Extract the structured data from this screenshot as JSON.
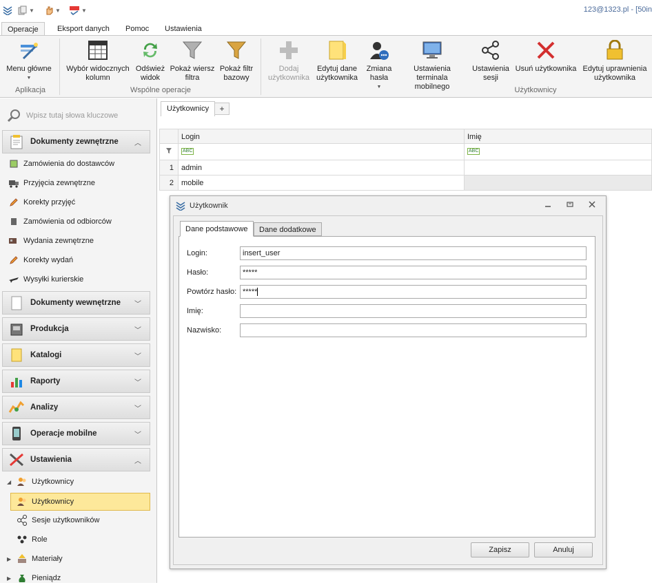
{
  "account": {
    "text": "123@1323.pl - [50in"
  },
  "ribbon_tabs": [
    "Operacje",
    "Eksport danych",
    "Pomoc",
    "Ustawienia"
  ],
  "ribbon": {
    "buttons": {
      "menu": "Menu główne",
      "columns": "Wybór widocznych kolumn",
      "refresh": "Odśwież widok",
      "show_filter_row": "Pokaż wiersz filtra",
      "show_base_filter": "Pokaż filtr bazowy",
      "add_user": "Dodaj użytkownika",
      "edit_user": "Edytuj dane użytkownika",
      "change_password": "Zmiana hasła",
      "mobile_terminal": "Ustawienia terminala mobilnego",
      "session_settings": "Ustawienia sesji",
      "delete_user": "Usuń użytkownika",
      "edit_permissions": "Edytuj uprawnienia użytkownika"
    },
    "groups": {
      "app": "Aplikacja",
      "common": "Wspólne operacje",
      "users": "Użytkownicy"
    }
  },
  "search": {
    "placeholder": "Wpisz tutaj słowa kluczowe"
  },
  "nav": {
    "groups": {
      "external_docs": "Dokumenty zewnętrzne",
      "internal_docs": "Dokumenty wewnętrzne",
      "production": "Produkcja",
      "catalogs": "Katalogi",
      "reports": "Raporty",
      "analyses": "Analizy",
      "mobile_ops": "Operacje mobilne",
      "settings": "Ustawienia"
    },
    "external_items": [
      "Zamówienia do dostawców",
      "Przyjęcia zewnętrzne",
      "Korekty przyjęć",
      "Zamówienia od odbiorców",
      "Wydania zewnętrzne",
      "Korekty wydań",
      "Wysyłki kurierskie"
    ],
    "settings_items": {
      "users_parent": "Użytkownicy",
      "users": "Użytkownicy",
      "sessions": "Sesje użytkowników",
      "roles": "Role",
      "materials": "Materiały",
      "money": "Pieniądz"
    }
  },
  "document_tab": {
    "label": "Użytkownicy",
    "add": "+"
  },
  "grid": {
    "columns": [
      "Login",
      "Imię"
    ],
    "rows": [
      {
        "num": "1",
        "login": "admin",
        "name": ""
      },
      {
        "num": "2",
        "login": "mobile",
        "name": ""
      }
    ],
    "filter_badge": "ABC"
  },
  "dialog": {
    "title": "Użytkownik",
    "tabs": [
      "Dane podstawowe",
      "Dane dodatkowe"
    ],
    "fields": {
      "login_label": "Login:",
      "login_value": "insert_user",
      "password_label": "Hasło:",
      "password_value": "*****",
      "repeat_label": "Powtórz hasło:",
      "repeat_value": "*****",
      "firstname_label": "Imię:",
      "firstname_value": "",
      "lastname_label": "Nazwisko:",
      "lastname_value": ""
    },
    "buttons": {
      "save": "Zapisz",
      "cancel": "Anuluj"
    }
  }
}
